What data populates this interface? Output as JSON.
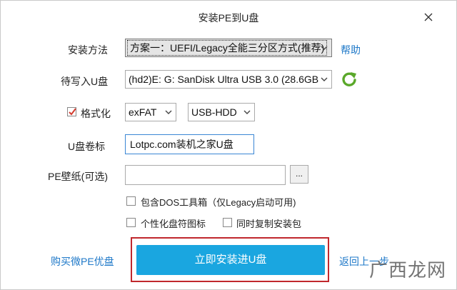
{
  "window": {
    "title": "安装PE到U盘"
  },
  "install_method": {
    "label": "安装方法",
    "value": "方案一：UEFI/Legacy全能三分区方式(推荐)",
    "help_link": "帮助"
  },
  "target_disk": {
    "label": "待写入U盘",
    "value": "(hd2)E: G: SanDisk Ultra USB 3.0 (28.6GB"
  },
  "format": {
    "label": "格式化",
    "checked": true,
    "filesystem": "exFAT",
    "mode": "USB-HDD"
  },
  "volume_label": {
    "label": "U盘卷标",
    "value": "Lotpc.com装机之家U盘"
  },
  "wallpaper": {
    "label": "PE壁纸(可选)",
    "value": "",
    "browse_label": "..."
  },
  "options": {
    "include_dos": "包含DOS工具箱（仅Legacy启动可用)",
    "custom_icon": "个性化盘符图标",
    "copy_package": "同时复制安装包"
  },
  "footer": {
    "buy_link": "购买微PE优盘",
    "install_button": "立即安装进U盘",
    "back_link": "返回上一步"
  },
  "watermark": {
    "text": "广西龙网"
  },
  "colors": {
    "accent": "#1aa6e0",
    "link": "#1e78c8",
    "highlight_frame": "#c0282d",
    "refresh": "#5aa82a"
  }
}
